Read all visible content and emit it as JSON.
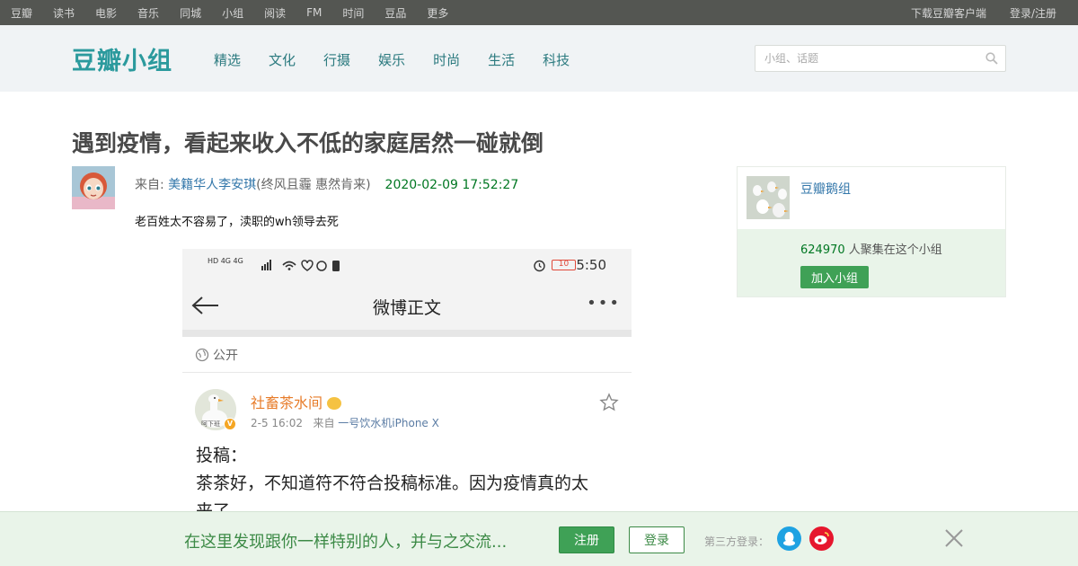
{
  "topnav": {
    "items": [
      "豆瓣",
      "读书",
      "电影",
      "音乐",
      "同城",
      "小组",
      "阅读",
      "FM",
      "时间",
      "豆品",
      "更多"
    ],
    "download": "下载豆瓣客户端",
    "login": "登录/注册"
  },
  "header": {
    "logo": "豆瓣小组",
    "nav": [
      "精选",
      "文化",
      "行摄",
      "娱乐",
      "时尚",
      "生活",
      "科技"
    ],
    "search_placeholder": "小组、话题"
  },
  "post": {
    "title": "遇到疫情，看起来收入不低的家庭居然一碰就倒",
    "from_label": "来自: ",
    "author": "美籍华人李安琪",
    "author_note": "(终风且霾 惠然肯来)",
    "time": "2020-02-09 17:52:27",
    "text": "老百姓太不容易了，渎职的wh领导去死"
  },
  "screenshot": {
    "status_signal": "HD 4G 4G",
    "battery": "10",
    "clock": "5:50",
    "title": "微博正文",
    "visibility": "公开",
    "username": "社畜茶水间",
    "meta_time": "2-5 16:02",
    "meta_from": "来自",
    "source": "一号饮水机iPhone X",
    "avatar_label": "阿下班",
    "line1": "投稿：",
    "line2": "茶茶好，不知道符不符合投稿标准。因为疫情真的太",
    "line3": "来了。"
  },
  "group": {
    "name": "豆瓣鹅组",
    "count": "624970",
    "count_suffix": " 人聚集在这个小组",
    "join": "加入小组"
  },
  "banner": {
    "slogan": "在这里发现跟你一样特别的人，并与之交流...",
    "register": "注册",
    "login": "登录",
    "third_party": "第三方登录："
  },
  "colors": {
    "topnav_bg": "#545652",
    "header_bg": "#f0f3f5",
    "logo": "#2b9a9d",
    "link": "#3377aa",
    "green": "#3fa156",
    "time": "#007722"
  }
}
